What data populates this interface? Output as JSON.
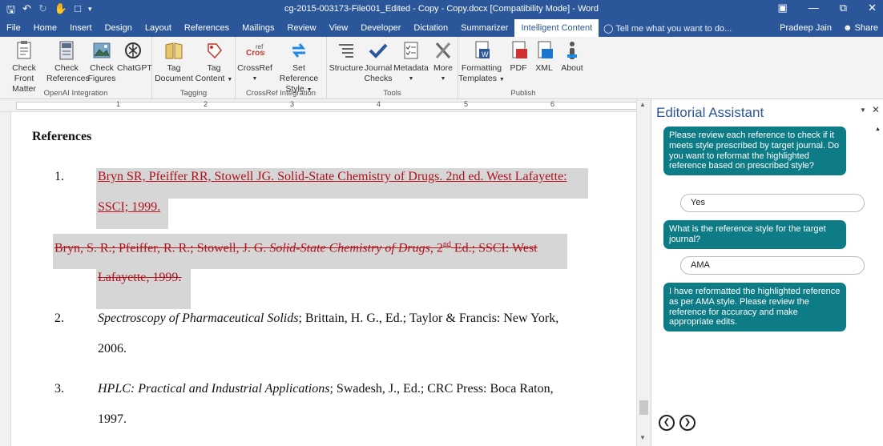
{
  "window": {
    "title": "cg-2015-003173-File001_Edited - Copy - Copy.docx [Compatibility Mode] - Word"
  },
  "qat": {
    "save_icon": "save-icon",
    "undo_icon": "undo-icon",
    "redo_icon": "redo-icon",
    "touch_icon": "touch-mode-icon",
    "screen_icon": "screen-icon",
    "customize_icon": "customize-icon"
  },
  "tabs": [
    {
      "label": "File"
    },
    {
      "label": "Home"
    },
    {
      "label": "Insert"
    },
    {
      "label": "Design"
    },
    {
      "label": "Layout"
    },
    {
      "label": "References"
    },
    {
      "label": "Mailings"
    },
    {
      "label": "Review"
    },
    {
      "label": "View"
    },
    {
      "label": "Developer"
    },
    {
      "label": "Dictation"
    },
    {
      "label": "Summarizer"
    },
    {
      "label": "Intelligent Content"
    }
  ],
  "tell_me": "Tell me what you want to do...",
  "user": "Pradeep Jain",
  "share": "Share",
  "ribbon": {
    "groups": [
      {
        "label": "OpenAI Integration"
      },
      {
        "label": "Tagging"
      },
      {
        "label": "CrossRef Integration"
      },
      {
        "label": "Tools"
      },
      {
        "label": "Publish"
      }
    ],
    "buttons": {
      "check_front_matter": {
        "line1": "Check Front",
        "line2": "Matter"
      },
      "check_references": {
        "line1": "Check",
        "line2": "References"
      },
      "check_figures": {
        "line1": "Check",
        "line2": "Figures"
      },
      "chatgpt": {
        "line1": "ChatGPT",
        "line2": ""
      },
      "tag_document": {
        "line1": "Tag",
        "line2": "Document"
      },
      "tag_content": {
        "line1": "Tag",
        "line2": "Content"
      },
      "crossref": {
        "line1": "CrossRef",
        "line2": ""
      },
      "set_reference_style": {
        "line1": "Set Reference",
        "line2": "Style"
      },
      "structure": {
        "line1": "Structure",
        "line2": ""
      },
      "journal_checks": {
        "line1": "Journal",
        "line2": "Checks"
      },
      "metadata": {
        "line1": "Metadata",
        "line2": ""
      },
      "more": {
        "line1": "More",
        "line2": ""
      },
      "formatting_templates": {
        "line1": "Formatting",
        "line2": "Templates"
      },
      "pdf": {
        "line1": "PDF",
        "line2": ""
      },
      "xml": {
        "line1": "XML",
        "line2": ""
      },
      "about": {
        "line1": "About",
        "line2": ""
      }
    }
  },
  "ruler": {
    "marks": [
      "1",
      "2",
      "3",
      "4",
      "5",
      "6"
    ]
  },
  "document": {
    "heading": "References",
    "items": [
      {
        "number": "1.",
        "inserted_line1": "Bryn SR, Pfeiffer RR, Stowell JG. Solid-State Chemistry of Drugs. 2nd ed. West Lafayette:",
        "inserted_line2": "SSCI; 1999.",
        "deleted_part1": "Bryn, S. R.; Pfeiffer, R. R.; Stowell, J. G. ",
        "deleted_italic": "Solid-State Chemistry of Drugs",
        "deleted_part2": ", 2",
        "deleted_sup": "nd",
        "deleted_part3": " Ed.; SSCI:  West",
        "deleted_line2": "Lafayette, 1999."
      },
      {
        "number": "2.",
        "italic": "Spectroscopy of Pharmaceutical Solids",
        "rest": "; Brittain, H. G., Ed.; Taylor & Francis:  New York,",
        "line2": "2006."
      },
      {
        "number": "3.",
        "italic": "HPLC:  Practical and Industrial Applications",
        "rest": "; Swadesh, J., Ed.; CRC Press:  Boca Raton,",
        "line2": "1997."
      }
    ]
  },
  "pane": {
    "title": "Editorial Assistant",
    "messages": [
      {
        "type": "bot",
        "text": "Please review each reference to check if it meets style prescribed by target journal. Do you want to reformat the highlighted reference based on prescribed style?"
      },
      {
        "type": "user",
        "text": "Yes"
      },
      {
        "type": "bot",
        "text": "What is the reference style for the target journal?"
      },
      {
        "type": "user",
        "text": "AMA"
      },
      {
        "type": "bot",
        "text": "I have reformatted the highlighted reference as per AMA style. Please review the reference for accuracy and make appropriate edits."
      }
    ],
    "nav_prev": "back-icon",
    "nav_next": "forward-icon"
  },
  "colors": {
    "brand": "#2b579a",
    "bubble": "#0e7c86",
    "revision": "#b0121b"
  }
}
